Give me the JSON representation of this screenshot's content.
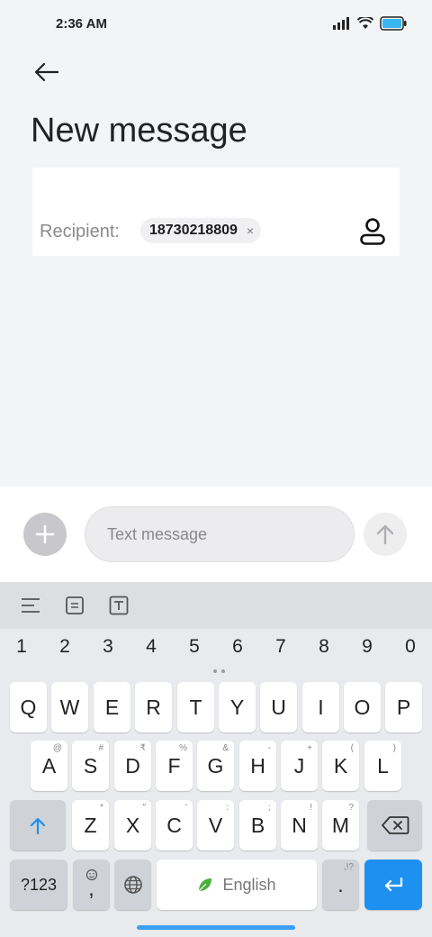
{
  "status_bar": {
    "time": "2:36 AM"
  },
  "header": {
    "title": "New message"
  },
  "recipient": {
    "label": "Recipient:",
    "chip_text": "18730218809",
    "chip_close": "×"
  },
  "compose": {
    "placeholder": "Text message"
  },
  "keyboard": {
    "numbers": [
      "1",
      "2",
      "3",
      "4",
      "5",
      "6",
      "7",
      "8",
      "9",
      "0"
    ],
    "row1": [
      {
        "label": "Q"
      },
      {
        "label": "W"
      },
      {
        "label": "E"
      },
      {
        "label": "R"
      },
      {
        "label": "T"
      },
      {
        "label": "Y"
      },
      {
        "label": "U"
      },
      {
        "label": "I"
      },
      {
        "label": "O"
      },
      {
        "label": "P"
      }
    ],
    "row2": [
      {
        "label": "A",
        "hint": "@"
      },
      {
        "label": "S",
        "hint": "#"
      },
      {
        "label": "D",
        "hint": "₹"
      },
      {
        "label": "F",
        "hint": "%"
      },
      {
        "label": "G",
        "hint": "&"
      },
      {
        "label": "H",
        "hint": "-"
      },
      {
        "label": "J",
        "hint": "+"
      },
      {
        "label": "K",
        "hint": "("
      },
      {
        "label": "L",
        "hint": ")"
      }
    ],
    "row3": [
      {
        "label": "Z",
        "hint": "*"
      },
      {
        "label": "X",
        "hint": "\""
      },
      {
        "label": "C",
        "hint": "'"
      },
      {
        "label": "V",
        "hint": ":"
      },
      {
        "label": "B",
        "hint": ";"
      },
      {
        "label": "N",
        "hint": "!"
      },
      {
        "label": "M",
        "hint": "?"
      }
    ],
    "symbols_label": "?123",
    "comma_label": ",",
    "space_label": "English",
    "period_label": ".",
    "period_hint": ",!?"
  },
  "colors": {
    "accent": "#1e90f0",
    "home_indicator": "#3aa0f5"
  }
}
